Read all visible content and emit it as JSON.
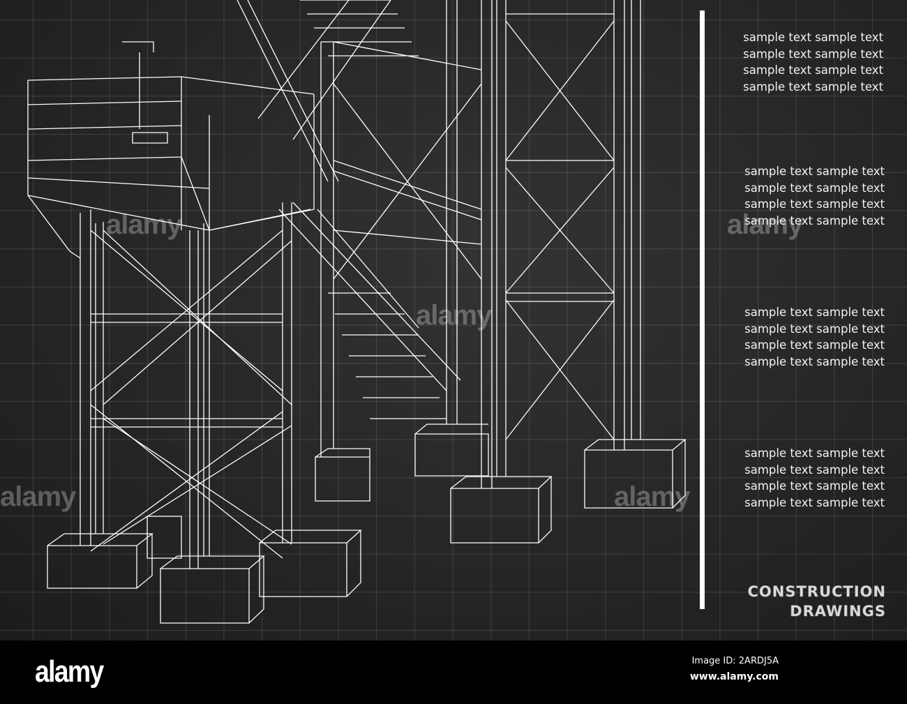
{
  "text_blocks": [
    [
      "sample text sample text",
      "sample text sample text",
      "sample text sample text",
      "sample text sample text"
    ],
    [
      "sample text sample text",
      "sample text sample text",
      "sample text sample text",
      "sample text sample text"
    ],
    [
      "sample text sample text",
      "sample text sample text",
      "sample text sample text",
      "sample text sample text"
    ],
    [
      "sample text sample text",
      "sample text sample text",
      "sample text sample text",
      "sample text sample text"
    ]
  ],
  "title": {
    "line1": "CONSTRUCTION",
    "line2": "DRAWINGS"
  },
  "footer": {
    "logo": "alamy",
    "image_id": "Image ID: 2ARDJ5A",
    "url": "www.alamy.com"
  },
  "watermark": "alamy",
  "colors": {
    "background": "#262626",
    "lines": "#ffffff",
    "footer": "#000000"
  }
}
